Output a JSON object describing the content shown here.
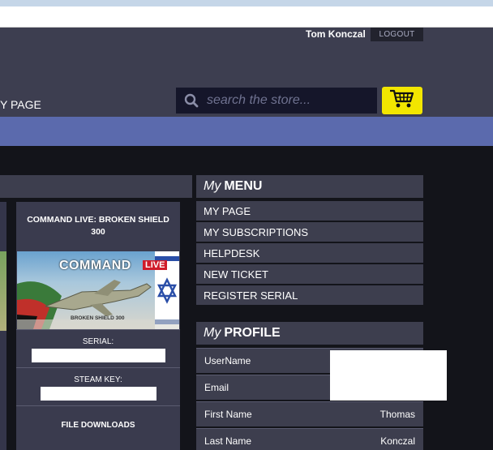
{
  "header": {
    "user_name": "Tom Konczal",
    "logout_label": "LOGOUT",
    "nav_page_label": "Y PAGE",
    "search": {
      "placeholder": "search the store..."
    }
  },
  "card": {
    "title": "COMMAND LIVE: BROKEN SHIELD 300",
    "image_logo_text": "COMMAND",
    "image_live_badge": "LIVE",
    "image_subtitle": "BROKEN SHIELD 300",
    "serial_label": "SERIAL:",
    "steam_key_label": "STEAM KEY:",
    "file_downloads_label": "FILE DOWNLOADS"
  },
  "menu": {
    "title_my": "My",
    "title_main": "MENU",
    "items": [
      {
        "label": "MY PAGE"
      },
      {
        "label": "MY SUBSCRIPTIONS"
      },
      {
        "label": "HELPDESK"
      },
      {
        "label": "NEW TICKET"
      },
      {
        "label": "REGISTER SERIAL"
      }
    ]
  },
  "profile": {
    "title_my": "My",
    "title_main": "PROFILE",
    "rows": [
      {
        "label": "UserName",
        "value": ""
      },
      {
        "label": "Email",
        "value": ""
      },
      {
        "label": "First Name",
        "value": "Thomas"
      },
      {
        "label": "Last Name",
        "value": "Konczal"
      }
    ]
  },
  "colors": {
    "header_bg": "#3d3e50",
    "accent_band": "#5b6aad",
    "cart_yellow": "#f2e600",
    "panel_bg": "#3d3e4e"
  }
}
